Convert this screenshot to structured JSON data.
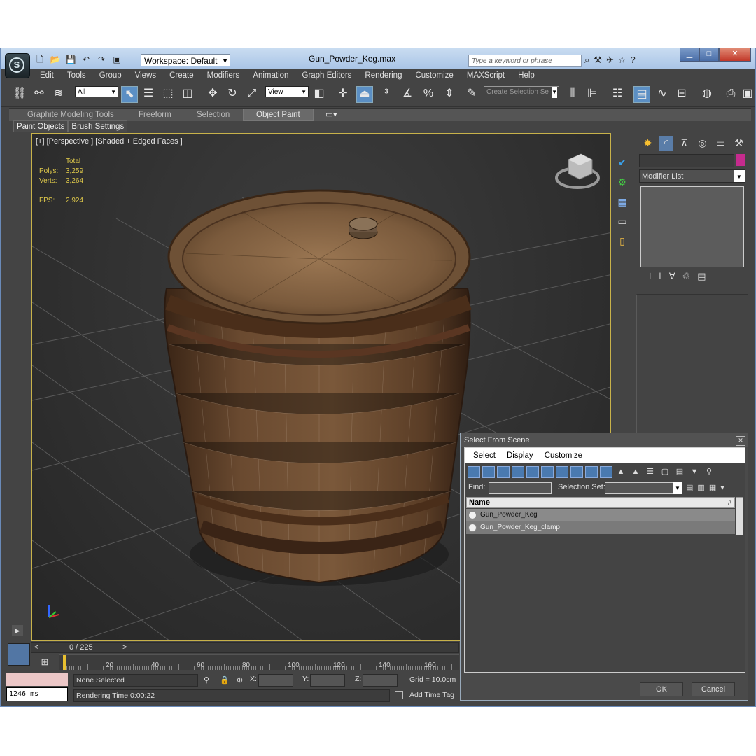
{
  "window": {
    "title": "Gun_Powder_Keg.max",
    "workspace": "Workspace: Default",
    "search_placeholder": "Type a keyword or phrase"
  },
  "menu": [
    "Edit",
    "Tools",
    "Group",
    "Views",
    "Create",
    "Modifiers",
    "Animation",
    "Graph Editors",
    "Rendering",
    "Customize",
    "MAXScript",
    "Help"
  ],
  "toolbar": {
    "filter_value": "All",
    "ref_coord_value": "View",
    "selection_set_placeholder": "Create Selection Se"
  },
  "ribbon": {
    "tabs": [
      "Graphite Modeling Tools",
      "Freeform",
      "Selection",
      "Object Paint"
    ],
    "selected_tab": "Object Paint",
    "subtabs": [
      "Paint Objects",
      "Brush Settings"
    ]
  },
  "viewport": {
    "label": "[+] [Perspective ] [Shaded + Edged Faces ]",
    "stats": {
      "header": "Total",
      "polys_label": "Polys:",
      "polys_value": "3,259",
      "verts_label": "Verts:",
      "verts_value": "3,264",
      "fps_label": "FPS:",
      "fps_value": "2.924"
    }
  },
  "command_panel": {
    "modifier_list": "Modifier List",
    "object_color": "#c62b8e"
  },
  "timeline": {
    "frame_display": "0 / 225",
    "ticks": [
      "20",
      "40",
      "60",
      "80",
      "100",
      "120",
      "140",
      "160"
    ]
  },
  "status": {
    "selection": "None Selected",
    "render_time": "Rendering Time  0:00:22",
    "x_label": "X:",
    "y_label": "Y:",
    "z_label": "Z:",
    "grid": "Grid = 10.0cm",
    "add_time_tag": "Add Time Tag",
    "ms_value": "1246 ms"
  },
  "dialog": {
    "title": "Select From Scene",
    "menu": [
      "Select",
      "Display",
      "Customize"
    ],
    "find_label": "Find:",
    "selection_set_label": "Selection Set:",
    "column_name": "Name",
    "items": [
      "Gun_Powder_Keg",
      "Gun_Powder_Keg_clamp"
    ],
    "ok": "OK",
    "cancel": "Cancel"
  }
}
